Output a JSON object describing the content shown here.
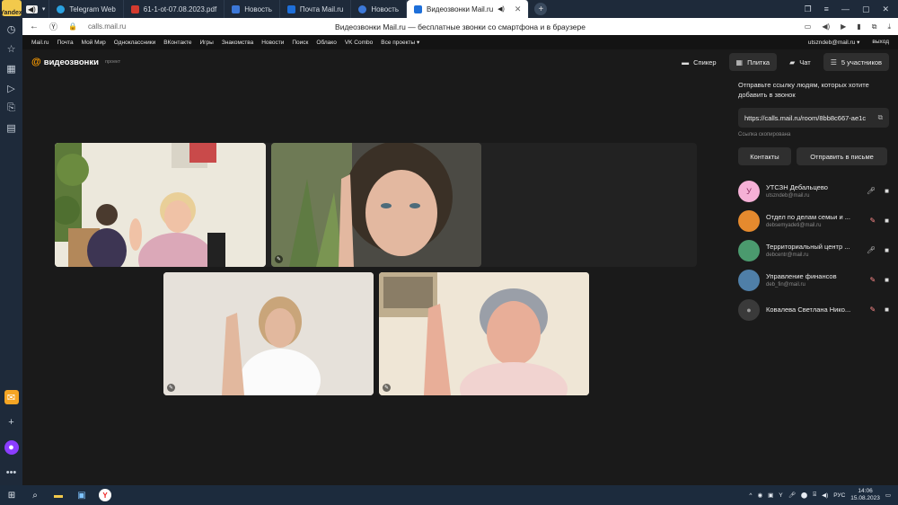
{
  "browser": {
    "yandex_button_label": "Yandex",
    "tabs": [
      {
        "label": "Telegram Web",
        "color": "#2aa1e0",
        "active": false
      },
      {
        "label": "61-1-ot-07.08.2023.pdf",
        "color": "#d33b2f",
        "active": false
      },
      {
        "label": "Новость",
        "color": "#3c78d8",
        "active": false
      },
      {
        "label": "Почта Mail.ru",
        "color": "#1e6fd9",
        "active": false
      },
      {
        "label": "Новость",
        "color": "#3c78d8",
        "active": false
      },
      {
        "label": "Видеозвонки Mail.ru",
        "color": "#1e6fd9",
        "active": true
      }
    ],
    "url": "calls.mail.ru",
    "page_title": "Видеозвонки Mail.ru — бесплатные звонки со смартфона и в браузере"
  },
  "mailnav": {
    "items": [
      "Mail.ru",
      "Почта",
      "Мой Мир",
      "Одноклассники",
      "ВКонтакте",
      "Игры",
      "Знакомства",
      "Новости",
      "Поиск",
      "Облако",
      "VK Combo",
      "Все проекты ▾"
    ],
    "account": "utszndeb@mail.ru ▾",
    "logout": "выход"
  },
  "app": {
    "logo_text": "видеозвонки",
    "logo_tag": "проект",
    "views": {
      "speaker": "Спикер",
      "tile": "Плитка",
      "chat": "Чат",
      "participants": "5 участников"
    }
  },
  "panel": {
    "hint": "Отправьте ссылку людям, которых хотите добавить в звонок",
    "link": "https://calls.mail.ru/room/8bb8c667-ae1c",
    "copied": "Ссылка скопирована",
    "contacts_button": "Контакты",
    "send_email_button": "Отправить в письме",
    "participants": [
      {
        "name": "УТСЗН Дебальцево",
        "email": "utszndeb@mail.ru",
        "avatar": "У",
        "avatar_color": "#f5b0d6",
        "mic_muted": false
      },
      {
        "name": "Отдел по делам семьи и ...",
        "email": "debsemyadeti@mail.ru",
        "avatar": "",
        "avatar_color": "#e58a2e",
        "mic_muted": true
      },
      {
        "name": "Территориальный центр ...",
        "email": "debcentr@mail.ru",
        "avatar": "",
        "avatar_color": "#4b9a6e",
        "mic_muted": false
      },
      {
        "name": "Управление финансов",
        "email": "deb_fin@mail.ru",
        "avatar": "",
        "avatar_color": "#4f7fa8",
        "mic_muted": true
      },
      {
        "name": "Ковалева Светлана Нико...",
        "email": "",
        "avatar": "",
        "avatar_color": "#3a3a3a",
        "mic_muted": true
      }
    ]
  },
  "taskbar": {
    "lang": "РУС",
    "time": "14:06",
    "date": "15.08.2023"
  }
}
